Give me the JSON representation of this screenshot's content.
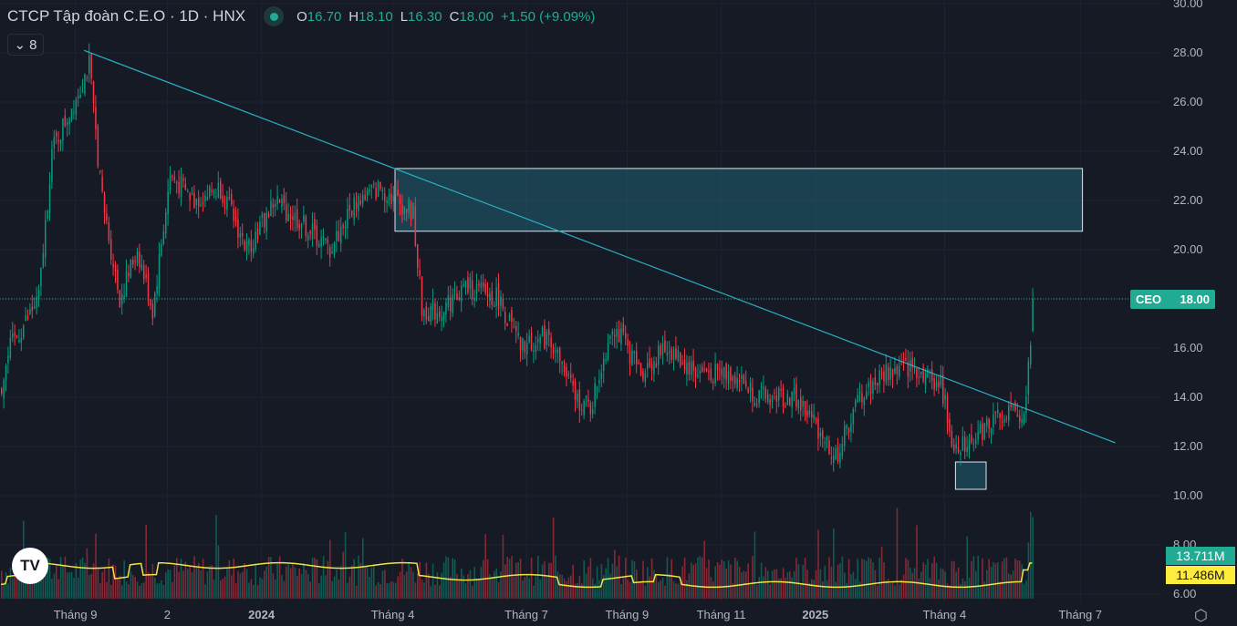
{
  "header": {
    "title": "CTCP Tập đoàn C.E.O · 1D · HNX",
    "ohlc": {
      "o_label": "O",
      "o": "16.70",
      "h_label": "H",
      "h": "18.10",
      "l_label": "L",
      "l": "16.30",
      "c_label": "C",
      "c": "18.00",
      "change": "+1.50 (+9.09%)"
    },
    "indicators_count": "8"
  },
  "price_tag": {
    "symbol": "CEO",
    "value": "18.00"
  },
  "volume_tags": {
    "volume": "13.711M",
    "volume_ma": "11.486M"
  },
  "logo_text": "TV",
  "colors": {
    "up": "#089981",
    "down": "#f23645",
    "accent": "#22ab94",
    "trendline": "#2ab0c4",
    "ma": "#f0e442",
    "bg": "#161a25"
  },
  "chart_data": {
    "type": "candlestick",
    "symbol": "CEO",
    "y_ticks": [
      "30.00",
      "28.00",
      "26.00",
      "24.00",
      "22.00",
      "20.00",
      "18.00",
      "16.00",
      "14.00",
      "12.00",
      "10.00",
      "8.00",
      "6.00"
    ],
    "ylim": [
      6,
      30
    ],
    "x_ticks": [
      "Tháng 9",
      "2",
      "2024",
      "Tháng 4",
      "Tháng 7",
      "Tháng 9",
      "Tháng 11",
      "2025",
      "Tháng 4",
      "Tháng 7"
    ],
    "x_tick_index": [
      34,
      76,
      119,
      179,
      240,
      286,
      329,
      372,
      431,
      493
    ],
    "close_path": [
      [
        0,
        14.5
      ],
      [
        4,
        16
      ],
      [
        17,
        18
      ],
      [
        23,
        24
      ],
      [
        33,
        26
      ],
      [
        40,
        27.5
      ],
      [
        46,
        22
      ],
      [
        54,
        18
      ],
      [
        62,
        20
      ],
      [
        69,
        17.5
      ],
      [
        77,
        23
      ],
      [
        88,
        22
      ],
      [
        100,
        22.5
      ],
      [
        112,
        20
      ],
      [
        125,
        22
      ],
      [
        138,
        21
      ],
      [
        150,
        20
      ],
      [
        162,
        22
      ],
      [
        173,
        22.5
      ],
      [
        181,
        22
      ],
      [
        188,
        21.5
      ],
      [
        192,
        17.5
      ],
      [
        200,
        17.5
      ],
      [
        212,
        18.5
      ],
      [
        227,
        18
      ],
      [
        237,
        16
      ],
      [
        250,
        16.5
      ],
      [
        262,
        14
      ],
      [
        269,
        13.5
      ],
      [
        279,
        17
      ],
      [
        292,
        15
      ],
      [
        304,
        16
      ],
      [
        317,
        15
      ],
      [
        333,
        15
      ],
      [
        346,
        14
      ],
      [
        362,
        14
      ],
      [
        375,
        12.5
      ],
      [
        381,
        11.5
      ],
      [
        392,
        14
      ],
      [
        404,
        15
      ],
      [
        417,
        15.2
      ],
      [
        429,
        14.5
      ],
      [
        435,
        12
      ],
      [
        446,
        12.5
      ],
      [
        458,
        13.5
      ],
      [
        466,
        13
      ],
      [
        469,
        15
      ],
      [
        471,
        18
      ]
    ],
    "trendline": {
      "start": [
        38,
        28.1
      ],
      "end": [
        509,
        12.15
      ]
    },
    "zones": [
      {
        "from": 180,
        "to": 494,
        "top": 23.3,
        "bottom": 20.75
      },
      {
        "from": 436,
        "to": 450,
        "top": 11.37,
        "bottom": 10.26
      }
    ],
    "last_price_line": 18.0
  }
}
